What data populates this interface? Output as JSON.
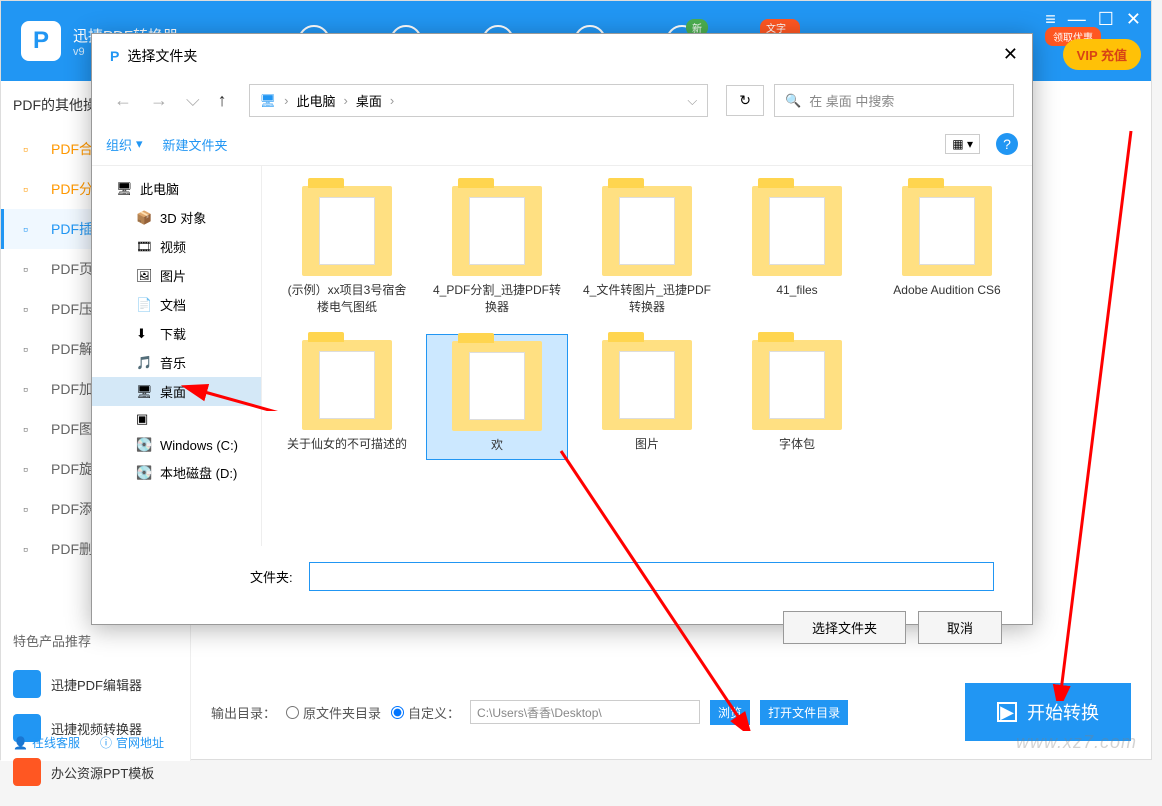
{
  "app": {
    "name": "迅捷PDF转换器",
    "version": "v9",
    "badges": {
      "new": "新",
      "ocr": "文字识别",
      "coupon": "领取优惠"
    },
    "vip": "VIP 充值"
  },
  "sidebar": {
    "header": "PDF的其他操",
    "items": [
      {
        "label": "PDF合",
        "active": false,
        "orange": true
      },
      {
        "label": "PDF分",
        "active": false,
        "orange": true
      },
      {
        "label": "PDF插",
        "active": true
      },
      {
        "label": "PDF页",
        "active": false
      },
      {
        "label": "PDF压",
        "active": false
      },
      {
        "label": "PDF解",
        "active": false
      },
      {
        "label": "PDF加",
        "active": false
      },
      {
        "label": "PDF图",
        "active": false
      },
      {
        "label": "PDF旋",
        "active": false
      },
      {
        "label": "PDF添",
        "active": false
      },
      {
        "label": "PDF删",
        "active": false
      }
    ]
  },
  "products": {
    "header": "特色产品推荐",
    "items": [
      {
        "label": "迅捷PDF编辑器",
        "color": "#2196F3"
      },
      {
        "label": "迅捷视频转换器",
        "color": "#2196F3"
      },
      {
        "label": "办公资源PPT模板",
        "color": "#FF5722"
      }
    ]
  },
  "footer": {
    "service": "在线客服",
    "website": "官网地址"
  },
  "output": {
    "label": "输出目录：",
    "opt1": "原文件夹目录",
    "opt2": "自定义：",
    "path": "C:\\Users\\香香\\Desktop\\",
    "browse": "浏览",
    "open": "打开文件目录",
    "start": "开始转换"
  },
  "dialog": {
    "title": "选择文件夹",
    "breadcrumb": {
      "root": "此电脑",
      "current": "桌面"
    },
    "search_placeholder": "在 桌面 中搜索",
    "toolbar": {
      "organize": "组织",
      "newfolder": "新建文件夹"
    },
    "tree": [
      {
        "label": "此电脑",
        "indent": 0
      },
      {
        "label": "3D 对象",
        "indent": 1
      },
      {
        "label": "视频",
        "indent": 1
      },
      {
        "label": "图片",
        "indent": 1
      },
      {
        "label": "文档",
        "indent": 1
      },
      {
        "label": "下载",
        "indent": 1
      },
      {
        "label": "音乐",
        "indent": 1
      },
      {
        "label": "桌面",
        "indent": 1,
        "selected": true
      },
      {
        "label": "",
        "indent": 1
      },
      {
        "label": "Windows (C:)",
        "indent": 1
      },
      {
        "label": "本地磁盘 (D:)",
        "indent": 1
      }
    ],
    "folders": [
      {
        "label": "(示例）xx项目3号宿舍楼电气图纸"
      },
      {
        "label": "4_PDF分割_迅捷PDF转换器"
      },
      {
        "label": "4_文件转图片_迅捷PDF转换器"
      },
      {
        "label": "41_files"
      },
      {
        "label": "Adobe Audition CS6"
      },
      {
        "label": "关于仙女的不可描述的"
      },
      {
        "label": "欢",
        "selected": true
      },
      {
        "label": "图片"
      },
      {
        "label": "字体包"
      }
    ],
    "folder_label": "文件夹:",
    "folder_value": "",
    "confirm": "选择文件夹",
    "cancel": "取消"
  },
  "watermark": "www.xz7.com"
}
